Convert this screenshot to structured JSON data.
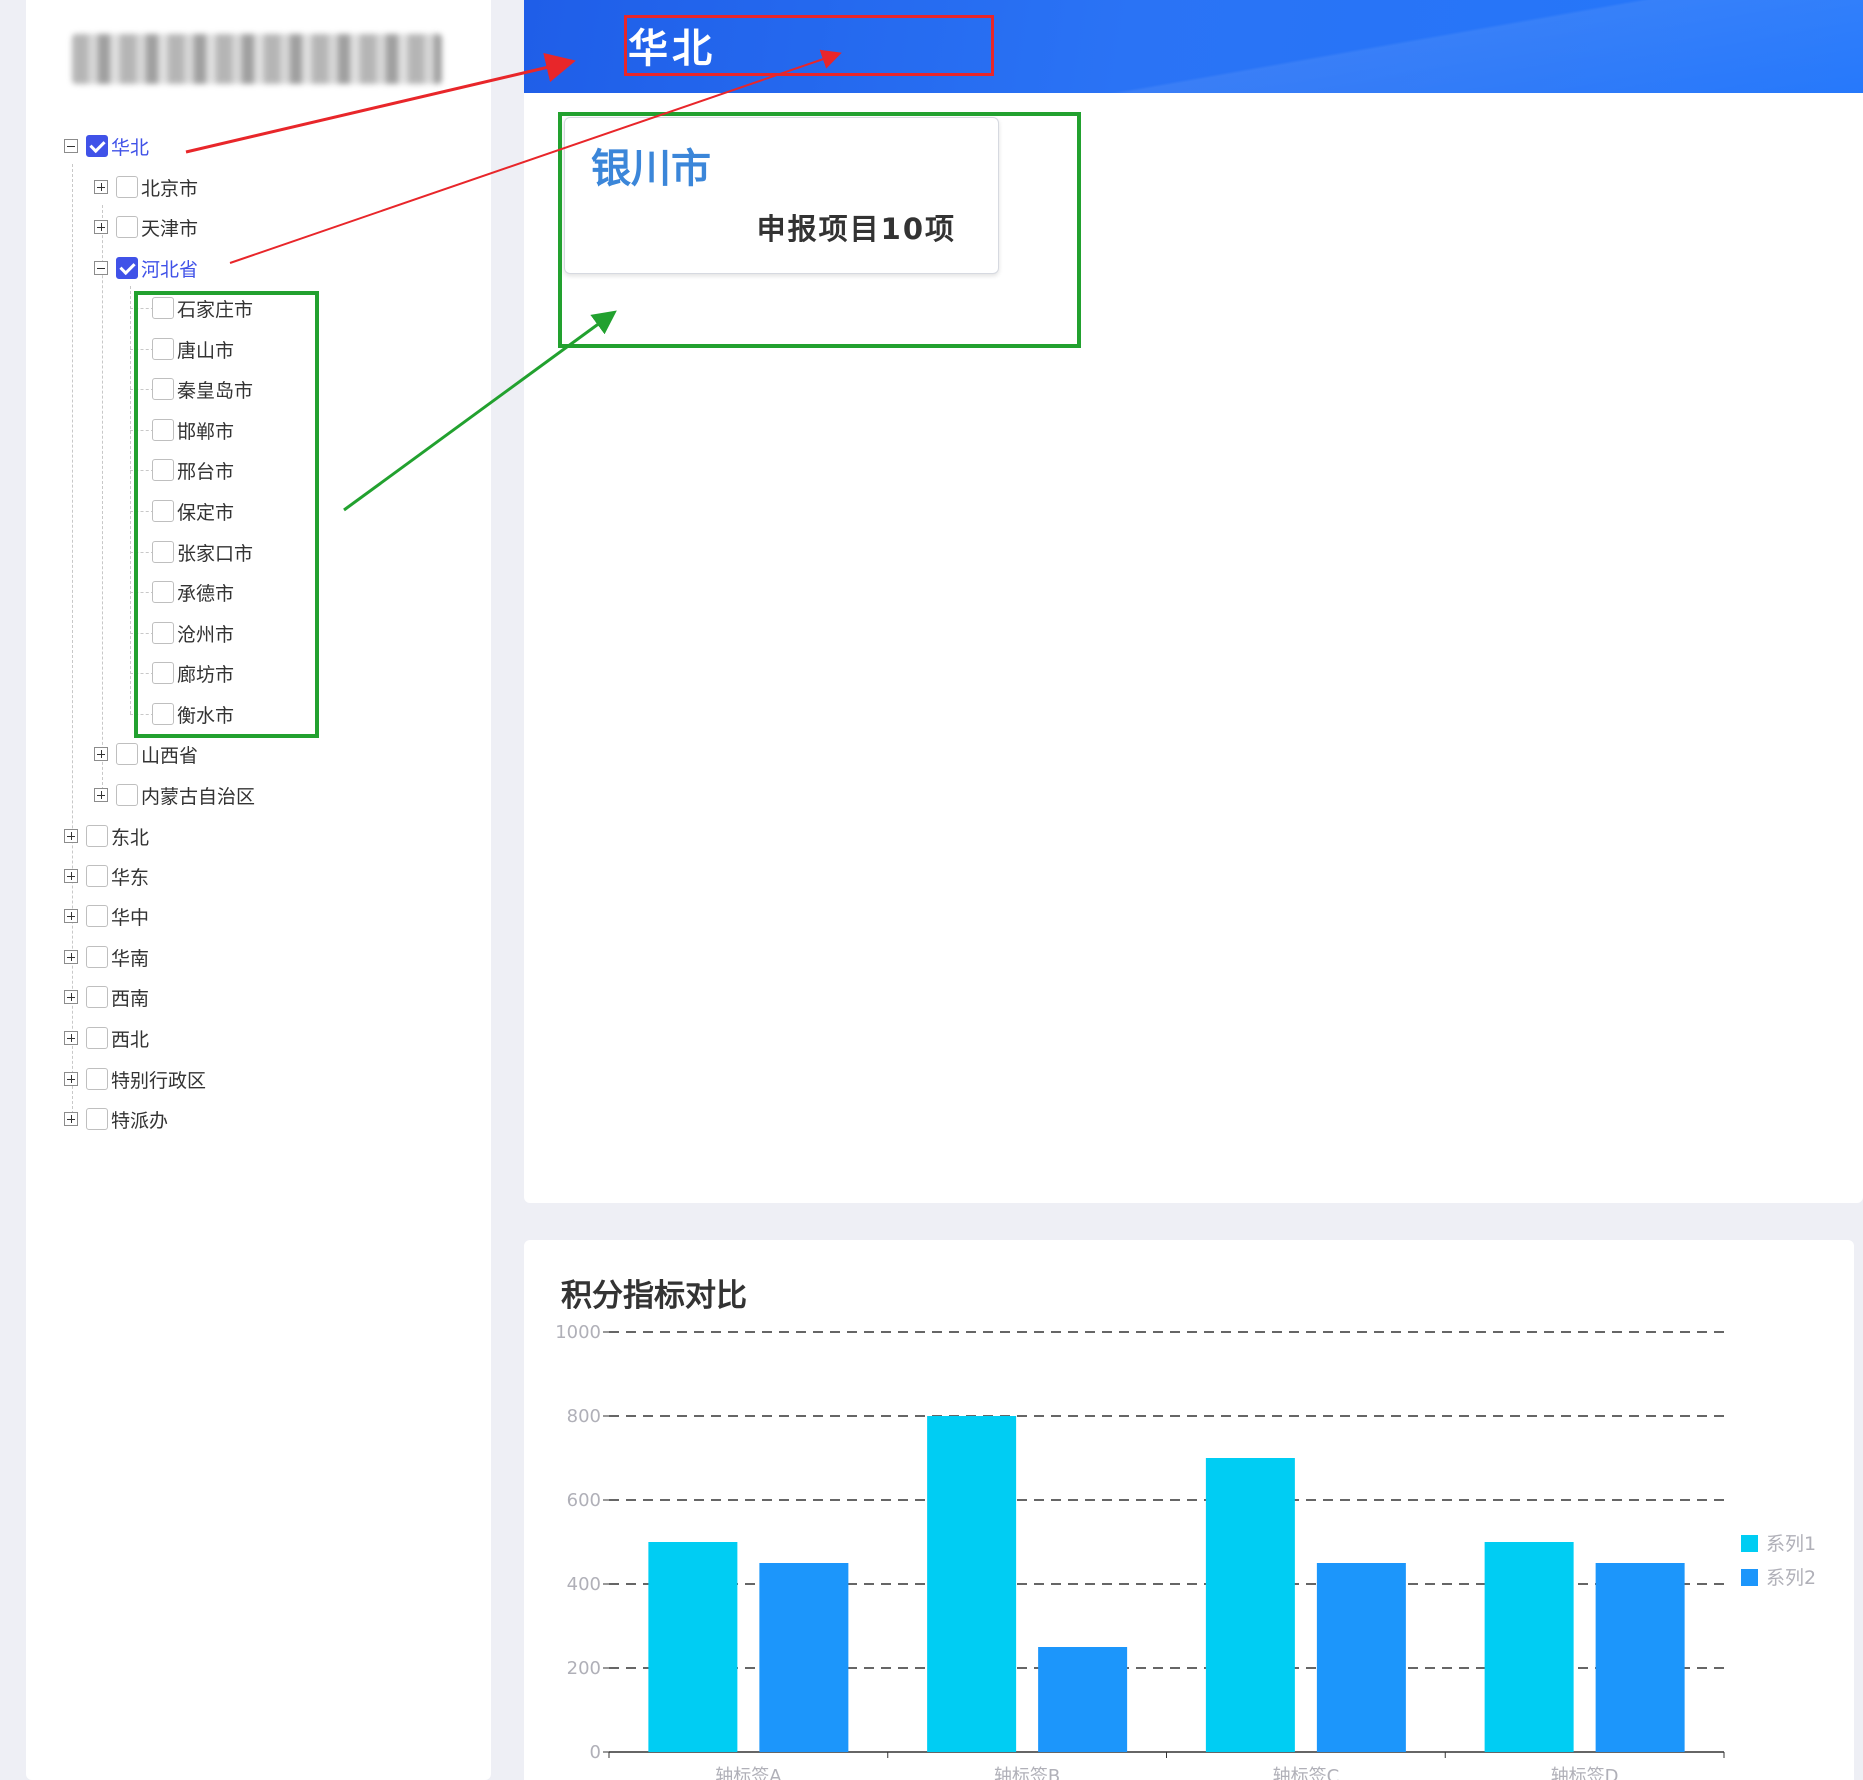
{
  "sidebar": {
    "tree": [
      {
        "label": "华北",
        "checked": true,
        "expanded": true
      },
      {
        "label": "北京市",
        "checked": false,
        "expanded": false
      },
      {
        "label": "天津市",
        "checked": false,
        "expanded": false
      },
      {
        "label": "河北省",
        "checked": true,
        "expanded": true
      },
      {
        "label": "石家庄市",
        "checked": false
      },
      {
        "label": "唐山市",
        "checked": false
      },
      {
        "label": "秦皇岛市",
        "checked": false
      },
      {
        "label": "邯郸市",
        "checked": false
      },
      {
        "label": "邢台市",
        "checked": false
      },
      {
        "label": "保定市",
        "checked": false
      },
      {
        "label": "张家口市",
        "checked": false
      },
      {
        "label": "承德市",
        "checked": false
      },
      {
        "label": "沧州市",
        "checked": false
      },
      {
        "label": "廊坊市",
        "checked": false
      },
      {
        "label": "衡水市",
        "checked": false
      },
      {
        "label": "山西省",
        "checked": false,
        "expanded": false
      },
      {
        "label": "内蒙古自治区",
        "checked": false,
        "expanded": false
      },
      {
        "label": "东北",
        "checked": false,
        "expanded": false
      },
      {
        "label": "华东",
        "checked": false,
        "expanded": false
      },
      {
        "label": "华中",
        "checked": false,
        "expanded": false
      },
      {
        "label": "华南",
        "checked": false,
        "expanded": false
      },
      {
        "label": "西南",
        "checked": false,
        "expanded": false
      },
      {
        "label": "西北",
        "checked": false,
        "expanded": false
      },
      {
        "label": "特别行政区",
        "checked": false,
        "expanded": false
      },
      {
        "label": "特派办",
        "checked": false,
        "expanded": false
      }
    ]
  },
  "banner": {
    "title": "华北"
  },
  "card": {
    "city": "银川市",
    "count_text": "申报项目10项"
  },
  "colors": {
    "accent": "#4052e8",
    "banner": "#2477fb",
    "series1": "#00cdf3",
    "series2": "#1c96fb",
    "annotation_red": "#e8262a",
    "annotation_green": "#22a12f"
  },
  "chart_data": {
    "type": "bar",
    "title": "积分指标对比",
    "categories": [
      "轴标签A",
      "轴标签B",
      "轴标签C",
      "轴标签D"
    ],
    "series": [
      {
        "name": "系列1",
        "values": [
          500,
          800,
          700,
          500
        ]
      },
      {
        "name": "系列2",
        "values": [
          450,
          250,
          450,
          450
        ]
      }
    ],
    "ylim": [
      0,
      1000
    ],
    "yticks": [
      0,
      200,
      400,
      600,
      800,
      1000
    ],
    "grid": true,
    "grid_style": "dashed",
    "legend": "right"
  }
}
